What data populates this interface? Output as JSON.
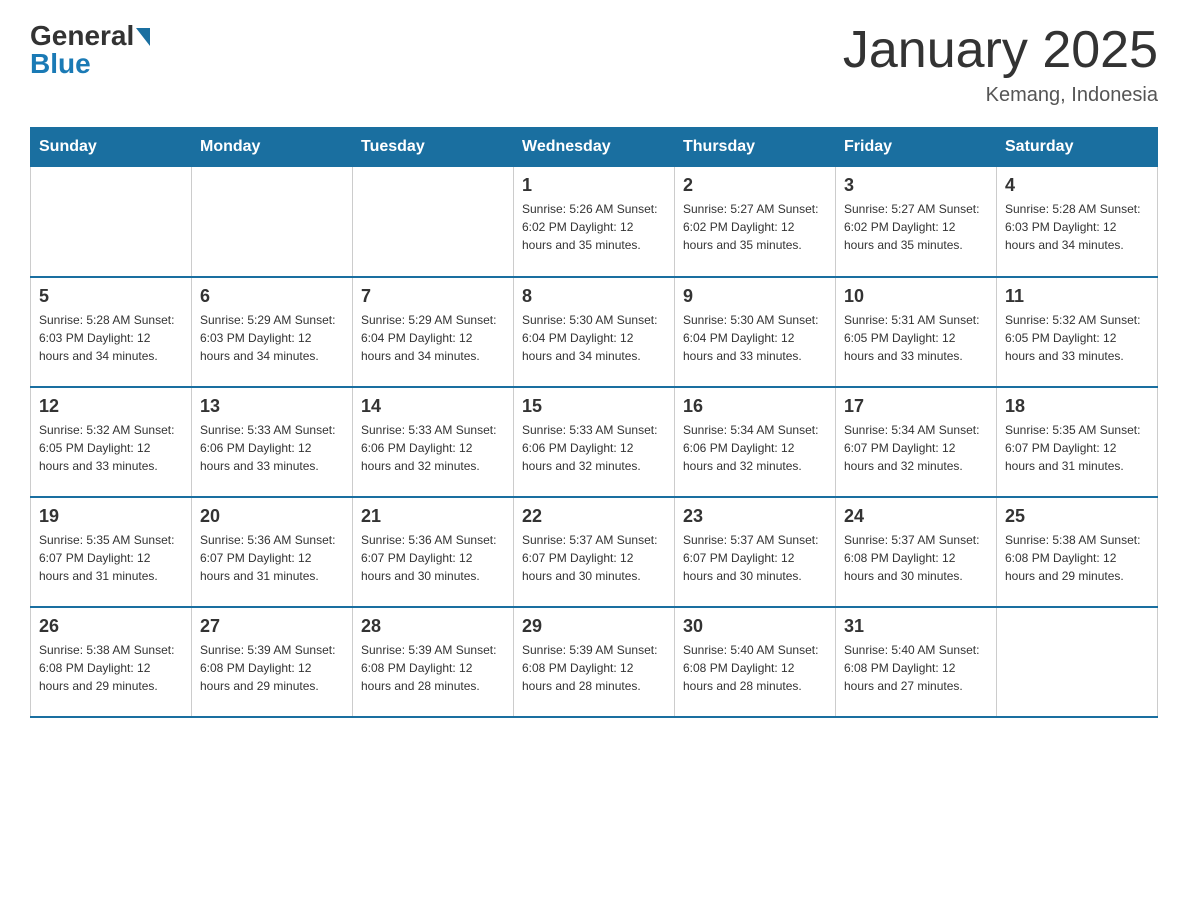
{
  "header": {
    "logo_general": "General",
    "logo_blue": "Blue",
    "month_title": "January 2025",
    "location": "Kemang, Indonesia"
  },
  "days_of_week": [
    "Sunday",
    "Monday",
    "Tuesday",
    "Wednesday",
    "Thursday",
    "Friday",
    "Saturday"
  ],
  "weeks": [
    [
      {
        "day": "",
        "info": ""
      },
      {
        "day": "",
        "info": ""
      },
      {
        "day": "",
        "info": ""
      },
      {
        "day": "1",
        "info": "Sunrise: 5:26 AM\nSunset: 6:02 PM\nDaylight: 12 hours and 35 minutes."
      },
      {
        "day": "2",
        "info": "Sunrise: 5:27 AM\nSunset: 6:02 PM\nDaylight: 12 hours and 35 minutes."
      },
      {
        "day": "3",
        "info": "Sunrise: 5:27 AM\nSunset: 6:02 PM\nDaylight: 12 hours and 35 minutes."
      },
      {
        "day": "4",
        "info": "Sunrise: 5:28 AM\nSunset: 6:03 PM\nDaylight: 12 hours and 34 minutes."
      }
    ],
    [
      {
        "day": "5",
        "info": "Sunrise: 5:28 AM\nSunset: 6:03 PM\nDaylight: 12 hours and 34 minutes."
      },
      {
        "day": "6",
        "info": "Sunrise: 5:29 AM\nSunset: 6:03 PM\nDaylight: 12 hours and 34 minutes."
      },
      {
        "day": "7",
        "info": "Sunrise: 5:29 AM\nSunset: 6:04 PM\nDaylight: 12 hours and 34 minutes."
      },
      {
        "day": "8",
        "info": "Sunrise: 5:30 AM\nSunset: 6:04 PM\nDaylight: 12 hours and 34 minutes."
      },
      {
        "day": "9",
        "info": "Sunrise: 5:30 AM\nSunset: 6:04 PM\nDaylight: 12 hours and 33 minutes."
      },
      {
        "day": "10",
        "info": "Sunrise: 5:31 AM\nSunset: 6:05 PM\nDaylight: 12 hours and 33 minutes."
      },
      {
        "day": "11",
        "info": "Sunrise: 5:32 AM\nSunset: 6:05 PM\nDaylight: 12 hours and 33 minutes."
      }
    ],
    [
      {
        "day": "12",
        "info": "Sunrise: 5:32 AM\nSunset: 6:05 PM\nDaylight: 12 hours and 33 minutes."
      },
      {
        "day": "13",
        "info": "Sunrise: 5:33 AM\nSunset: 6:06 PM\nDaylight: 12 hours and 33 minutes."
      },
      {
        "day": "14",
        "info": "Sunrise: 5:33 AM\nSunset: 6:06 PM\nDaylight: 12 hours and 32 minutes."
      },
      {
        "day": "15",
        "info": "Sunrise: 5:33 AM\nSunset: 6:06 PM\nDaylight: 12 hours and 32 minutes."
      },
      {
        "day": "16",
        "info": "Sunrise: 5:34 AM\nSunset: 6:06 PM\nDaylight: 12 hours and 32 minutes."
      },
      {
        "day": "17",
        "info": "Sunrise: 5:34 AM\nSunset: 6:07 PM\nDaylight: 12 hours and 32 minutes."
      },
      {
        "day": "18",
        "info": "Sunrise: 5:35 AM\nSunset: 6:07 PM\nDaylight: 12 hours and 31 minutes."
      }
    ],
    [
      {
        "day": "19",
        "info": "Sunrise: 5:35 AM\nSunset: 6:07 PM\nDaylight: 12 hours and 31 minutes."
      },
      {
        "day": "20",
        "info": "Sunrise: 5:36 AM\nSunset: 6:07 PM\nDaylight: 12 hours and 31 minutes."
      },
      {
        "day": "21",
        "info": "Sunrise: 5:36 AM\nSunset: 6:07 PM\nDaylight: 12 hours and 30 minutes."
      },
      {
        "day": "22",
        "info": "Sunrise: 5:37 AM\nSunset: 6:07 PM\nDaylight: 12 hours and 30 minutes."
      },
      {
        "day": "23",
        "info": "Sunrise: 5:37 AM\nSunset: 6:07 PM\nDaylight: 12 hours and 30 minutes."
      },
      {
        "day": "24",
        "info": "Sunrise: 5:37 AM\nSunset: 6:08 PM\nDaylight: 12 hours and 30 minutes."
      },
      {
        "day": "25",
        "info": "Sunrise: 5:38 AM\nSunset: 6:08 PM\nDaylight: 12 hours and 29 minutes."
      }
    ],
    [
      {
        "day": "26",
        "info": "Sunrise: 5:38 AM\nSunset: 6:08 PM\nDaylight: 12 hours and 29 minutes."
      },
      {
        "day": "27",
        "info": "Sunrise: 5:39 AM\nSunset: 6:08 PM\nDaylight: 12 hours and 29 minutes."
      },
      {
        "day": "28",
        "info": "Sunrise: 5:39 AM\nSunset: 6:08 PM\nDaylight: 12 hours and 28 minutes."
      },
      {
        "day": "29",
        "info": "Sunrise: 5:39 AM\nSunset: 6:08 PM\nDaylight: 12 hours and 28 minutes."
      },
      {
        "day": "30",
        "info": "Sunrise: 5:40 AM\nSunset: 6:08 PM\nDaylight: 12 hours and 28 minutes."
      },
      {
        "day": "31",
        "info": "Sunrise: 5:40 AM\nSunset: 6:08 PM\nDaylight: 12 hours and 27 minutes."
      },
      {
        "day": "",
        "info": ""
      }
    ]
  ]
}
